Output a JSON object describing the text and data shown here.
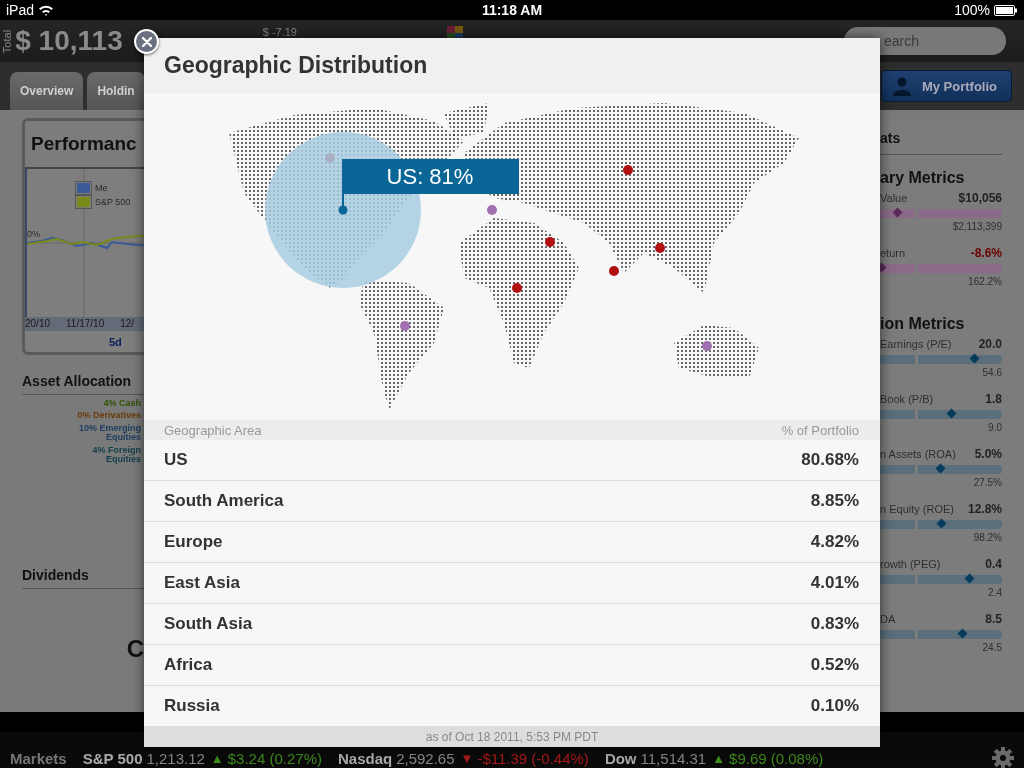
{
  "status_bar": {
    "device": "iPad",
    "time": "11:18 AM",
    "battery": "100%"
  },
  "header": {
    "total_label": "Total",
    "total_value": "$ 10,113",
    "change": "$ -7.19",
    "search": {
      "placeholder": "earch"
    }
  },
  "tabs": [
    {
      "label": "Overview"
    },
    {
      "label": "Holdin"
    }
  ],
  "portfolio_button": "My Portfolio",
  "performance": {
    "title": "Performanc",
    "legend": [
      {
        "label": "Me",
        "color": "#3a5a98"
      },
      {
        "label": "S&P 500",
        "color": "#7a8a1a"
      }
    ],
    "y_label": "0%",
    "x_labels": [
      "20/10",
      "11/17/10",
      "12/"
    ],
    "range": "5d"
  },
  "asset_allocation": {
    "title": "Asset Allocation",
    "items": [
      {
        "label": "4% Cash",
        "color": "#2e5200"
      },
      {
        "label": "0% Derivatives",
        "color": "#6a3a08"
      },
      {
        "label": "10% Emerging Equities",
        "color": "#1e3e62"
      },
      {
        "label": "4% Foreign Equities",
        "color": "#103e48"
      }
    ]
  },
  "dividends": {
    "title": "Dividends"
  },
  "fragment": "C",
  "stats": {
    "title": "ats",
    "groups": [
      {
        "title": "ary Metrics",
        "kind": "summary",
        "metrics": [
          {
            "label": "Value",
            "value": "$10,056",
            "max": "$2,113,399",
            "level": 0.15,
            "negative": false
          },
          {
            "label": "eturn",
            "value": "-8.6%",
            "max": "162.2%",
            "level": 0.02,
            "negative": true
          }
        ]
      },
      {
        "title": "ion Metrics",
        "kind": "valuation",
        "metrics": [
          {
            "label": "Earnings (P/E)",
            "value": "20.0",
            "max": "54.6",
            "level": 0.78,
            "negative": false
          },
          {
            "label": "Book (P/B)",
            "value": "1.8",
            "max": "9.0",
            "level": 0.59,
            "negative": false
          },
          {
            "label": "n Assets (ROA)",
            "value": "5.0%",
            "max": "27.5%",
            "level": 0.5,
            "negative": false
          },
          {
            "label": "n Equity (ROE)",
            "value": "12.8%",
            "max": "98.2%",
            "level": 0.51,
            "negative": false
          },
          {
            "label": "rowth (PEG)",
            "value": "0.4",
            "max": "2.4",
            "level": 0.74,
            "negative": false
          },
          {
            "label": "DA",
            "value": "8.5",
            "max": "24.5",
            "level": 0.68,
            "negative": false
          }
        ]
      }
    ]
  },
  "ticker": {
    "label": "Markets",
    "items": [
      {
        "name": "S&P 500",
        "price": "1,213.12",
        "arrow": "▲",
        "change": "$3.24 (0.27%)",
        "color": "#3f8a1e"
      },
      {
        "name": "Nasdaq",
        "price": "2,592.65",
        "arrow": "▼",
        "change": "-$11.39 (-0.44%)",
        "color": "#a81a1a"
      },
      {
        "name": "Dow",
        "price": "11,514.31",
        "arrow": "▲",
        "change": "$9.69 (0.08%)",
        "color": "#3f8a1e"
      }
    ]
  },
  "modal": {
    "title": "Geographic Distribution",
    "callout": "US: 81%",
    "columns": [
      "Geographic Area",
      "% of Portfolio"
    ],
    "rows": [
      {
        "area": "US",
        "share": "80.68%"
      },
      {
        "area": "South America",
        "share": "8.85%"
      },
      {
        "area": "Europe",
        "share": "4.82%"
      },
      {
        "area": "East Asia",
        "share": "4.01%"
      },
      {
        "area": "South Asia",
        "share": "0.83%"
      },
      {
        "area": "Africa",
        "share": "0.52%"
      },
      {
        "area": "Russia",
        "share": "0.10%"
      }
    ],
    "footer": "as of Oct 18 2011, 5:53 PM PDT"
  }
}
